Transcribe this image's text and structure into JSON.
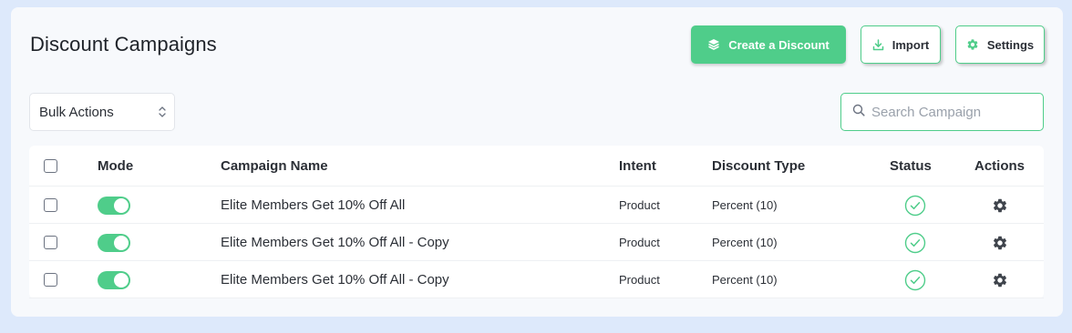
{
  "header": {
    "title": "Discount Campaigns",
    "create_label": "Create a Discount",
    "import_label": "Import",
    "settings_label": "Settings"
  },
  "toolbar": {
    "bulk_actions": "Bulk Actions",
    "search_placeholder": "Search Campaign"
  },
  "table": {
    "columns": [
      "Mode",
      "Campaign Name",
      "Intent",
      "Discount Type",
      "Status",
      "Actions"
    ],
    "rows": [
      {
        "name": "Elite Members Get 10% Off All",
        "intent": "Product",
        "discount_type": "Percent (10)",
        "mode_on": true,
        "status": "active"
      },
      {
        "name": "Elite Members Get 10% Off All - Copy",
        "intent": "Product",
        "discount_type": "Percent (10)",
        "mode_on": true,
        "status": "active"
      },
      {
        "name": "Elite Members Get 10% Off All - Copy",
        "intent": "Product",
        "discount_type": "Percent (10)",
        "mode_on": true,
        "status": "active"
      }
    ]
  },
  "colors": {
    "accent": "#4fcd8a",
    "background": "#dde9fb",
    "card": "#f7f9fc"
  },
  "icons": {
    "create": "layers-icon",
    "import": "download-icon",
    "settings": "gear-icon",
    "search": "search-icon",
    "status": "check-circle-icon",
    "actions": "gear-icon"
  }
}
